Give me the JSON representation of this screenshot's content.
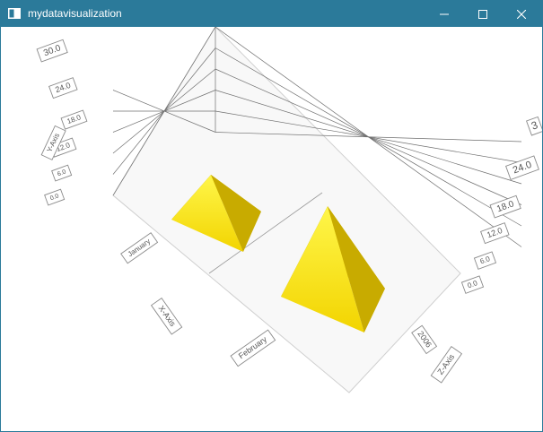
{
  "window": {
    "title": "mydatavisualization",
    "icon": "app-window-icon",
    "controls": {
      "minimize": "minimize-icon",
      "maximize": "maximize-icon",
      "close": "close-icon"
    }
  },
  "chart_data": {
    "type": "bar3d",
    "bar_shape": "pyramid",
    "y_axis": {
      "label": "Y-Axis",
      "ticks": [
        "0.0",
        "6.0",
        "12.0",
        "18.0",
        "24.0",
        "30.0"
      ],
      "range": [
        0,
        30
      ]
    },
    "x_axis": {
      "label": "X-Axis",
      "categories": [
        "January",
        "February"
      ]
    },
    "z_axis": {
      "label": "Z-Axis",
      "categories": [
        "2006"
      ]
    },
    "series": [
      {
        "z": "2006",
        "values": [
          12,
          25
        ]
      }
    ],
    "right_wall_ticks": [
      "0.0",
      "6.0",
      "12.0",
      "18.0",
      "24.0",
      "3"
    ],
    "colors": {
      "bar": "#f5d800",
      "bar_light": "#fff24a",
      "bar_dark": "#a88a00",
      "grid": "#6f6f6f",
      "floor": "#f8f8f8"
    }
  }
}
